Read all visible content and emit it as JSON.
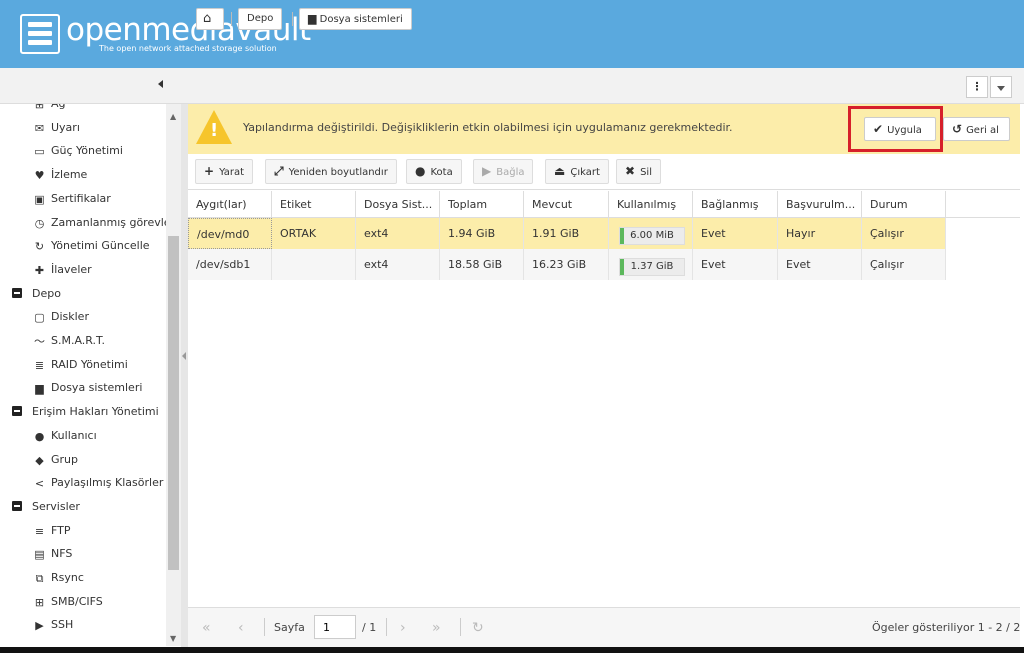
{
  "header": {
    "logo_text": "openmediavault",
    "tagline": "The open network attached storage solution"
  },
  "breadcrumb": [
    {
      "label": ""
    },
    {
      "label": "Depo"
    },
    {
      "label": "Dosya sistemleri"
    }
  ],
  "sidebar": {
    "items": [
      {
        "label": "Ağ",
        "icon": "network-icon",
        "glyph": "⊞",
        "level": 1
      },
      {
        "label": "Uyarı",
        "icon": "envelope-icon",
        "glyph": "✉",
        "level": 1
      },
      {
        "label": "Güç Yönetimi",
        "icon": "battery-icon",
        "glyph": "▭",
        "level": 1
      },
      {
        "label": "İzleme",
        "icon": "heartbeat-icon",
        "glyph": "♥",
        "level": 1
      },
      {
        "label": "Sertifikalar",
        "icon": "certificate-icon",
        "glyph": "▣",
        "level": 1
      },
      {
        "label": "Zamanlanmış görevler",
        "icon": "clock-icon",
        "glyph": "◷",
        "level": 1
      },
      {
        "label": "Yönetimi Güncelle",
        "icon": "refresh-icon",
        "glyph": "↻",
        "level": 1
      },
      {
        "label": "İlaveler",
        "icon": "puzzle-icon",
        "glyph": "✚",
        "level": 1
      },
      {
        "label": "Depo",
        "icon": "minus-square-icon",
        "glyph": "",
        "level": 0
      },
      {
        "label": "Diskler",
        "icon": "disk-icon",
        "glyph": "▢",
        "level": 1
      },
      {
        "label": "S.M.A.R.T.",
        "icon": "pulse-icon",
        "glyph": "〜",
        "level": 1
      },
      {
        "label": "RAID Yönetimi",
        "icon": "database-icon",
        "glyph": "≣",
        "level": 1
      },
      {
        "label": "Dosya sistemleri",
        "icon": "folder-icon",
        "glyph": "▆",
        "level": 1
      },
      {
        "label": "Erişim Hakları Yönetimi",
        "icon": "minus-square-icon",
        "glyph": "",
        "level": 0
      },
      {
        "label": "Kullanıcı",
        "icon": "user-icon",
        "glyph": "●",
        "level": 1
      },
      {
        "label": "Grup",
        "icon": "users-icon",
        "glyph": "◆",
        "level": 1
      },
      {
        "label": "Paylaşılmış Klasörler",
        "icon": "share-icon",
        "glyph": "<",
        "level": 1
      },
      {
        "label": "Servisler",
        "icon": "minus-square-icon",
        "glyph": "",
        "level": 0
      },
      {
        "label": "FTP",
        "icon": "server-icon",
        "glyph": "≡",
        "level": 1
      },
      {
        "label": "NFS",
        "icon": "server-icon",
        "glyph": "▤",
        "level": 1
      },
      {
        "label": "Rsync",
        "icon": "sitemap-icon",
        "glyph": "⧉",
        "level": 1
      },
      {
        "label": "SMB/CIFS",
        "icon": "windows-icon",
        "glyph": "⊞",
        "level": 1
      },
      {
        "label": "SSH",
        "icon": "terminal-icon",
        "glyph": "▶",
        "level": 1
      }
    ]
  },
  "warning": {
    "text": "Yapılandırma değiştirildi. Değişikliklerin etkin olabilmesi için uygulamanız gerekmektedir.",
    "apply_label": "Uygula",
    "revert_label": "Geri al"
  },
  "toolbar": {
    "create": "Yarat",
    "resize": "Yeniden boyutlandır",
    "quota": "Kota",
    "mount": "Bağla",
    "unmount": "Çıkart",
    "delete": "Sil"
  },
  "grid": {
    "columns": [
      "Aygıt(lar)",
      "Etiket",
      "Dosya Sist...",
      "Toplam",
      "Mevcut",
      "Kullanılmış",
      "Bağlanmış",
      "Başvurulm...",
      "Durum"
    ],
    "rows": [
      {
        "device": "/dev/md0",
        "label": "ORTAK",
        "fs": "ext4",
        "total": "1.94 GiB",
        "available": "1.91 GiB",
        "used": "6.00 MiB",
        "used_fraction": 0.003,
        "mounted": "Evet",
        "referenced": "Hayır",
        "status": "Çalışır"
      },
      {
        "device": "/dev/sdb1",
        "label": "",
        "fs": "ext4",
        "total": "18.58 GiB",
        "available": "16.23 GiB",
        "used": "1.37 GiB",
        "used_fraction": 0.07,
        "mounted": "Evet",
        "referenced": "Evet",
        "status": "Çalışır"
      }
    ]
  },
  "paging": {
    "page_label": "Sayfa",
    "page_value": "1",
    "page_total": "/ 1",
    "summary": "Ögeler gösteriliyor 1 - 2 / 2"
  },
  "colors": {
    "header": "#5aa9de",
    "warning": "#fcedaa",
    "highlight": "#d6202a",
    "usage_fill": "#5cb85c"
  }
}
